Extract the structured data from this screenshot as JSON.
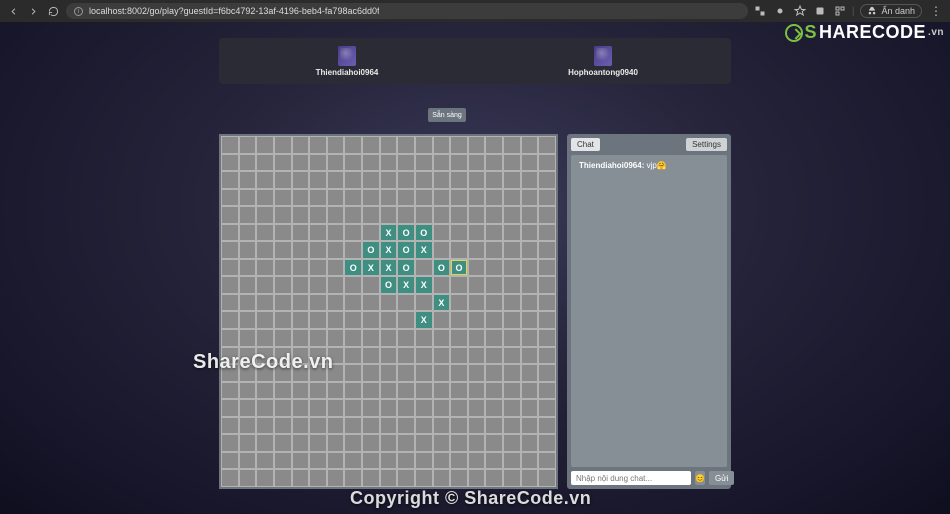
{
  "browser": {
    "url": "localhost:8002/go/play?guestId=f6bc4792-13af-4196-beb4-fa798ac6dd0f",
    "incognito_label": "Ẩn danh"
  },
  "players": {
    "left": {
      "name": "Thiendiahoi0964"
    },
    "right": {
      "name": "Hophoantong0940"
    }
  },
  "buttons": {
    "ready": "Sẵn sàng",
    "chat_tab": "Chat",
    "settings_tab": "Settings",
    "send": "Gửi",
    "emoji": "😊"
  },
  "chat": {
    "placeholder": "Nhập nội dung chat...",
    "messages": [
      {
        "user": "Thiendiahoi0964",
        "text": "vjp🤗"
      }
    ]
  },
  "board": {
    "cols": 19,
    "rows": 20,
    "highlight": {
      "row": 7,
      "col": 13
    },
    "moves": [
      {
        "row": 5,
        "col": 9,
        "m": "X"
      },
      {
        "row": 5,
        "col": 10,
        "m": "O"
      },
      {
        "row": 5,
        "col": 11,
        "m": "O"
      },
      {
        "row": 6,
        "col": 8,
        "m": "O"
      },
      {
        "row": 6,
        "col": 9,
        "m": "X"
      },
      {
        "row": 6,
        "col": 10,
        "m": "O"
      },
      {
        "row": 6,
        "col": 11,
        "m": "X"
      },
      {
        "row": 7,
        "col": 7,
        "m": "O"
      },
      {
        "row": 7,
        "col": 8,
        "m": "X"
      },
      {
        "row": 7,
        "col": 9,
        "m": "X"
      },
      {
        "row": 7,
        "col": 10,
        "m": "O"
      },
      {
        "row": 7,
        "col": 12,
        "m": "O"
      },
      {
        "row": 7,
        "col": 13,
        "m": "O"
      },
      {
        "row": 8,
        "col": 9,
        "m": "O"
      },
      {
        "row": 8,
        "col": 10,
        "m": "X"
      },
      {
        "row": 8,
        "col": 11,
        "m": "X"
      },
      {
        "row": 9,
        "col": 12,
        "m": "X"
      },
      {
        "row": 10,
        "col": 11,
        "m": "X"
      }
    ]
  },
  "watermark": {
    "logo_main": "HARECODE",
    "logo_suffix": ".vn",
    "center": "ShareCode.vn",
    "bottom": "Copyright © ShareCode.vn"
  }
}
